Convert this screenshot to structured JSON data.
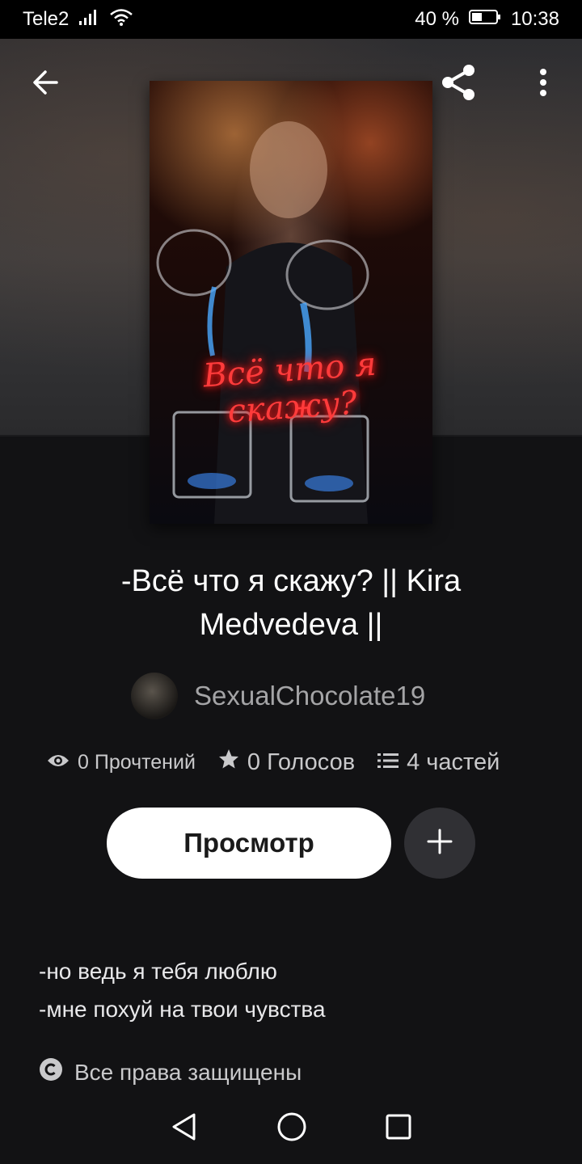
{
  "status_bar": {
    "carrier": "Tele2",
    "battery": "40 %",
    "time": "10:38"
  },
  "cover": {
    "overlay_text": "Всё что я скажу?"
  },
  "story": {
    "title": "-Всё что я скажу? || Kira Medvedeva ||",
    "author": "SexualChocolate19"
  },
  "stats": {
    "reads": "0 Прочтений",
    "votes": "0 Голосов",
    "parts": "4 частей"
  },
  "actions": {
    "view_label": "Просмотр"
  },
  "description": {
    "line1": "-но ведь я тебя люблю",
    "line2": "-мне похуй на твои чувства"
  },
  "copyright": {
    "label": "Все права защищены"
  },
  "icons": [
    "back-arrow-icon",
    "share-icon",
    "more-vert-icon",
    "eye-icon",
    "star-icon",
    "list-icon",
    "plus-icon",
    "copyright-icon",
    "nav-back-icon",
    "nav-home-icon",
    "nav-recents-icon"
  ],
  "colors": {
    "background": "#121214",
    "button_bg": "#ffffff",
    "muted_text": "#a4a4a6"
  }
}
